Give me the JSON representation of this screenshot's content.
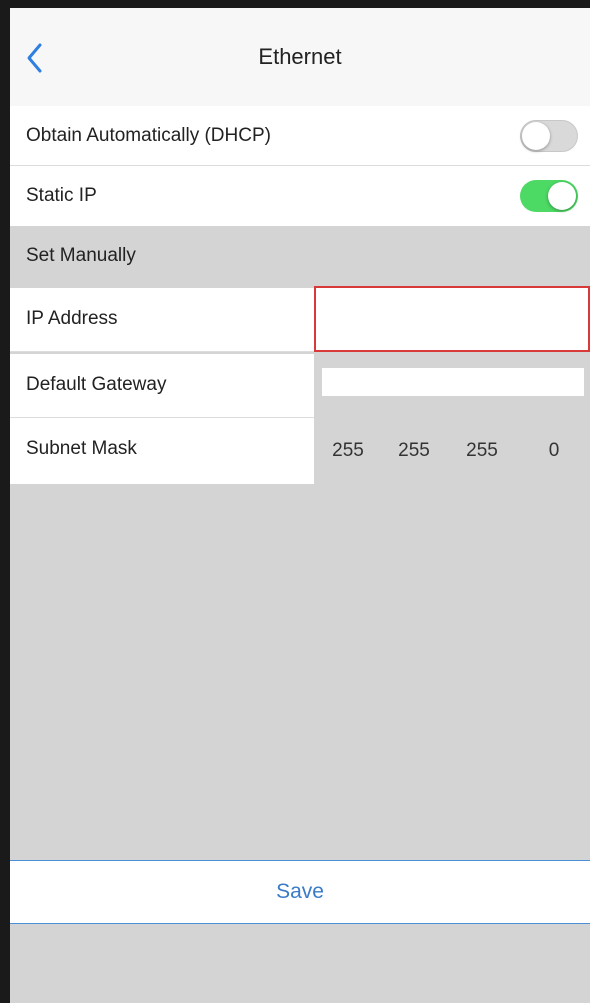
{
  "nav": {
    "title": "Ethernet"
  },
  "settings": {
    "dhcp_label": "Obtain Automatically (DHCP)",
    "dhcp_enabled": false,
    "static_label": "Static IP",
    "static_enabled": true
  },
  "section": {
    "title": "Set Manually"
  },
  "fields": {
    "ip_address": {
      "label": "IP Address",
      "value": ""
    },
    "default_gateway": {
      "label": "Default Gateway",
      "value": ""
    },
    "subnet_mask": {
      "label": "Subnet Mask",
      "octets": [
        "255",
        "255",
        "255",
        "0"
      ]
    }
  },
  "footer": {
    "save_label": "Save"
  },
  "colors": {
    "toggle_on": "#4cd964",
    "toggle_off": "#d9d9d9",
    "accent": "#3a7bc8",
    "focus_border": "#d83a3a"
  },
  "icons": {
    "back": "chevron-left-icon"
  }
}
